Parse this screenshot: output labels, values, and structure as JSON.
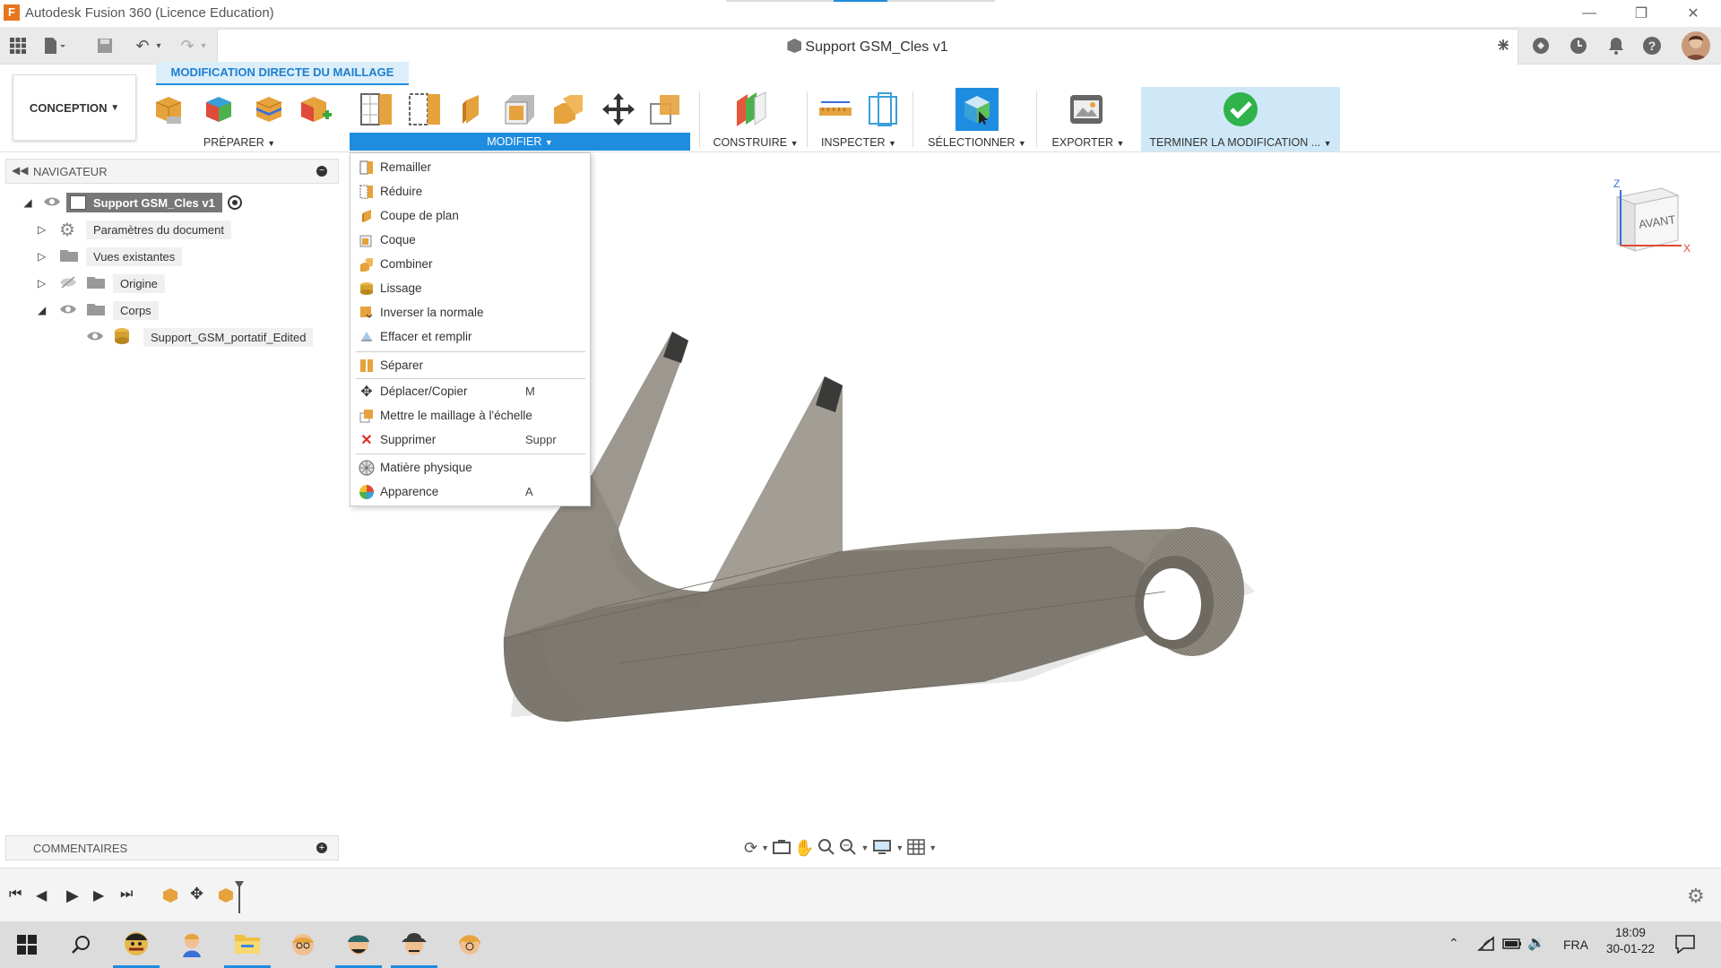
{
  "window": {
    "title": "Autodesk Fusion 360 (Licence Education)",
    "logo_letter": "F"
  },
  "document": {
    "title": "Support GSM_Cles v1"
  },
  "ribbon": {
    "workspace_label": "CONCEPTION",
    "context_tab": "MODIFICATION DIRECTE DU MAILLAGE",
    "groups": {
      "prepare": "PRÉPARER",
      "modify": "MODIFIER",
      "construct": "CONSTRUIRE",
      "inspect": "INSPECTER",
      "select": "SÉLECTIONNER",
      "export": "EXPORTER",
      "finish": "TERMINER LA MODIFICATION ..."
    }
  },
  "navigator": {
    "title": "NAVIGATEUR",
    "root": "Support GSM_Cles v1",
    "items": [
      {
        "label": "Paramètres du document"
      },
      {
        "label": "Vues existantes"
      },
      {
        "label": "Origine"
      },
      {
        "label": "Corps"
      },
      {
        "label": "Support_GSM_portatif_Edited"
      }
    ]
  },
  "modify_menu": {
    "items": [
      {
        "label": "Remailler",
        "shortcut": ""
      },
      {
        "label": "Réduire",
        "shortcut": ""
      },
      {
        "label": "Coupe de plan",
        "shortcut": ""
      },
      {
        "label": "Coque",
        "shortcut": ""
      },
      {
        "label": "Combiner",
        "shortcut": ""
      },
      {
        "label": "Lissage",
        "shortcut": ""
      },
      {
        "label": "Inverser la normale",
        "shortcut": ""
      },
      {
        "label": "Effacer et remplir",
        "shortcut": ""
      },
      {
        "label": "Séparer",
        "shortcut": ""
      },
      {
        "label": "Déplacer/Copier",
        "shortcut": "M"
      },
      {
        "label": "Mettre le maillage à l'échelle",
        "shortcut": ""
      },
      {
        "label": "Supprimer",
        "shortcut": "Suppr"
      },
      {
        "label": "Matière physique",
        "shortcut": ""
      },
      {
        "label": "Apparence",
        "shortcut": "A"
      }
    ]
  },
  "viewcube": {
    "face": "AVANT",
    "axis_z": "Z",
    "axis_x": "X"
  },
  "comments": {
    "title": "COMMENTAIRES"
  },
  "taskbar": {
    "language": "FRA",
    "time": "18:09",
    "date": "30-01-22"
  },
  "colors": {
    "accent": "#1e8de0",
    "finish_bg": "#cfe8f7",
    "model": "#8e8a80"
  }
}
